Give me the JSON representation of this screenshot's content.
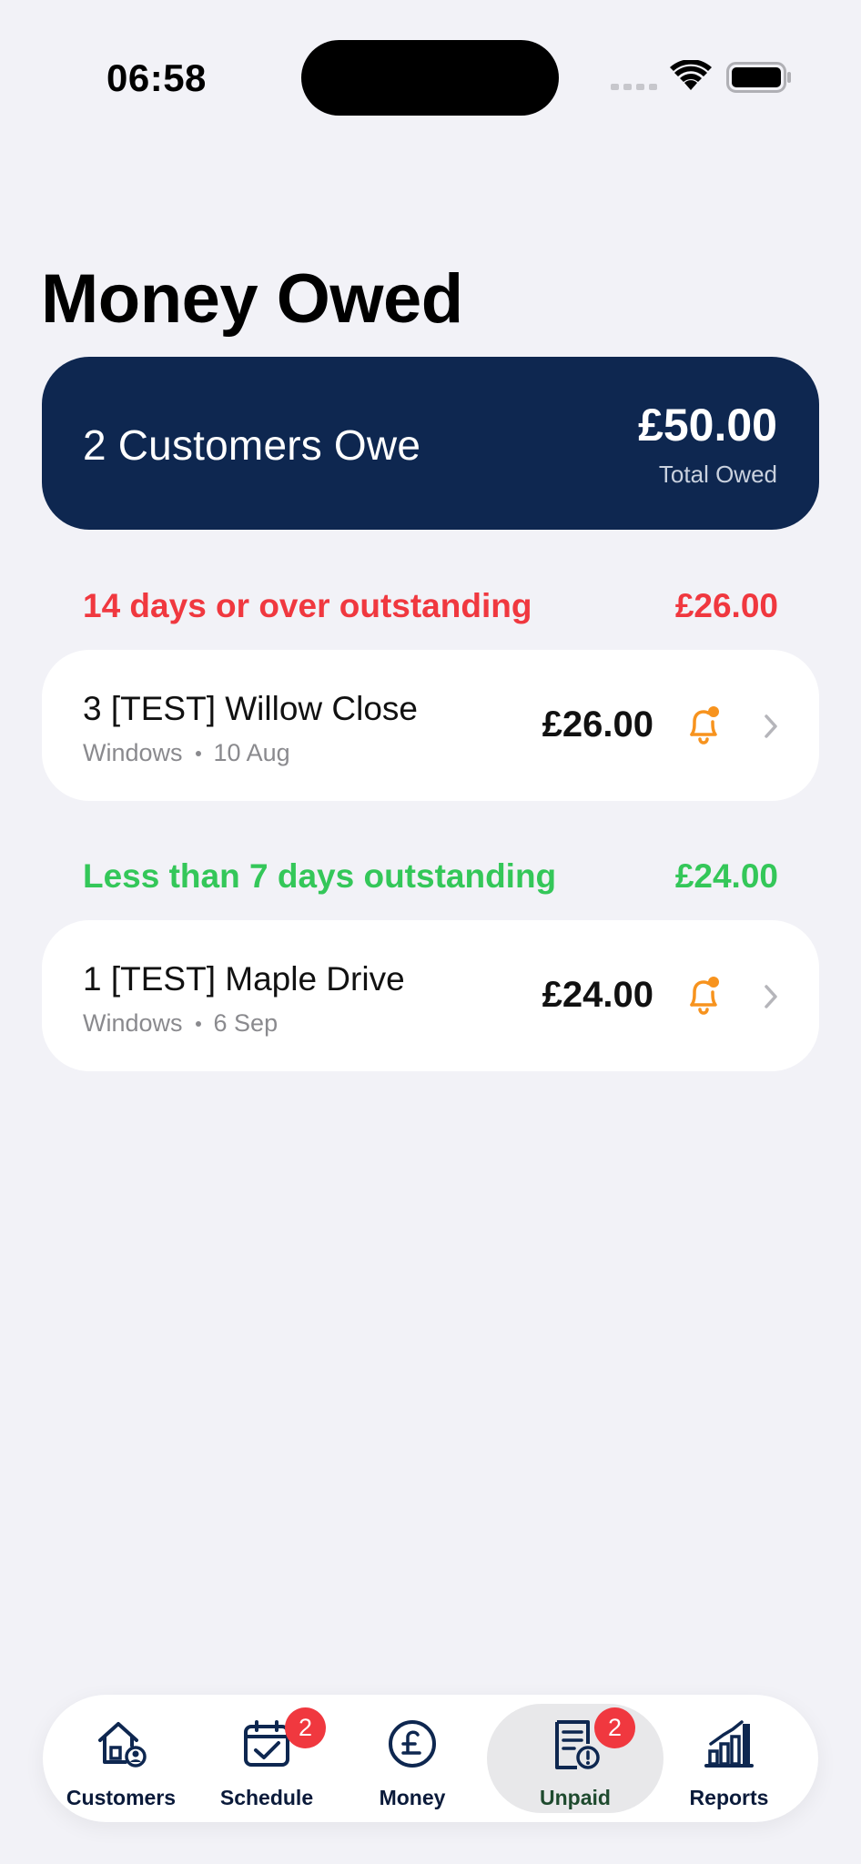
{
  "status_bar": {
    "time": "06:58"
  },
  "page": {
    "title": "Money Owed"
  },
  "summary": {
    "customers_owe": "2 Customers Owe",
    "total_amount": "£50.00",
    "total_caption": "Total Owed",
    "background_color": "#0e2750"
  },
  "sections": [
    {
      "label": "14 days or over outstanding",
      "total": "£26.00",
      "color": "#f0383f",
      "rows": [
        {
          "title": "3 [TEST] Willow Close",
          "service": "Windows",
          "date": "10 Aug",
          "amount": "£26.00",
          "icon": "bell-icon"
        }
      ]
    },
    {
      "label": "Less than 7 days outstanding",
      "total": "£24.00",
      "color": "#34c759",
      "rows": [
        {
          "title": "1 [TEST] Maple Drive",
          "service": "Windows",
          "date": "6 Sep",
          "amount": "£24.00",
          "icon": "bell-icon"
        }
      ]
    }
  ],
  "tab_bar": {
    "tabs": [
      {
        "label": "Customers",
        "icon": "house-person-icon"
      },
      {
        "label": "Schedule",
        "icon": "calendar-check-icon",
        "badge": "2"
      },
      {
        "label": "Money",
        "icon": "pound-circle-icon"
      },
      {
        "label": "Unpaid",
        "icon": "receipt-alert-icon",
        "badge": "2",
        "selected": true
      },
      {
        "label": "Reports",
        "icon": "bar-chart-icon"
      }
    ]
  }
}
